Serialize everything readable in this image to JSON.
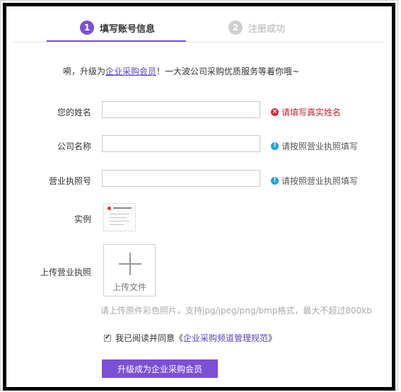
{
  "steps": [
    {
      "num": "1",
      "label": "填写账号信息"
    },
    {
      "num": "2",
      "label": "注册成功"
    }
  ],
  "intro": {
    "prefix": "嗬，升级为",
    "link": "企业采购会员",
    "suffix": "！一大波公司采购优质服务等着你哦~"
  },
  "form": {
    "name": {
      "label": "您的姓名",
      "value": "",
      "hint": "请填写真实姓名",
      "hint_type": "error"
    },
    "company": {
      "label": "公司名称",
      "value": "",
      "hint": "请按照营业执照填写",
      "hint_type": "info"
    },
    "license_no": {
      "label": "营业执照号",
      "value": "",
      "hint": "请按照营业执照填写",
      "hint_type": "info"
    },
    "sample_label": "实例",
    "upload_label": "上传营业执照",
    "upload_button": "上传文件",
    "upload_note": "请上传原件彩色照片，支持jpg/jpeg/png/bmp格式，最大不超过800kb"
  },
  "agreement": {
    "checked": true,
    "text": "我已阅读并同意《",
    "link": "企业采购频道管理规范",
    "close": "》"
  },
  "submit_label": "升级成为企业采购会员",
  "colors": {
    "accent": "#7b4fd6",
    "error": "#cc1d2a",
    "info": "#1e9ee8"
  }
}
